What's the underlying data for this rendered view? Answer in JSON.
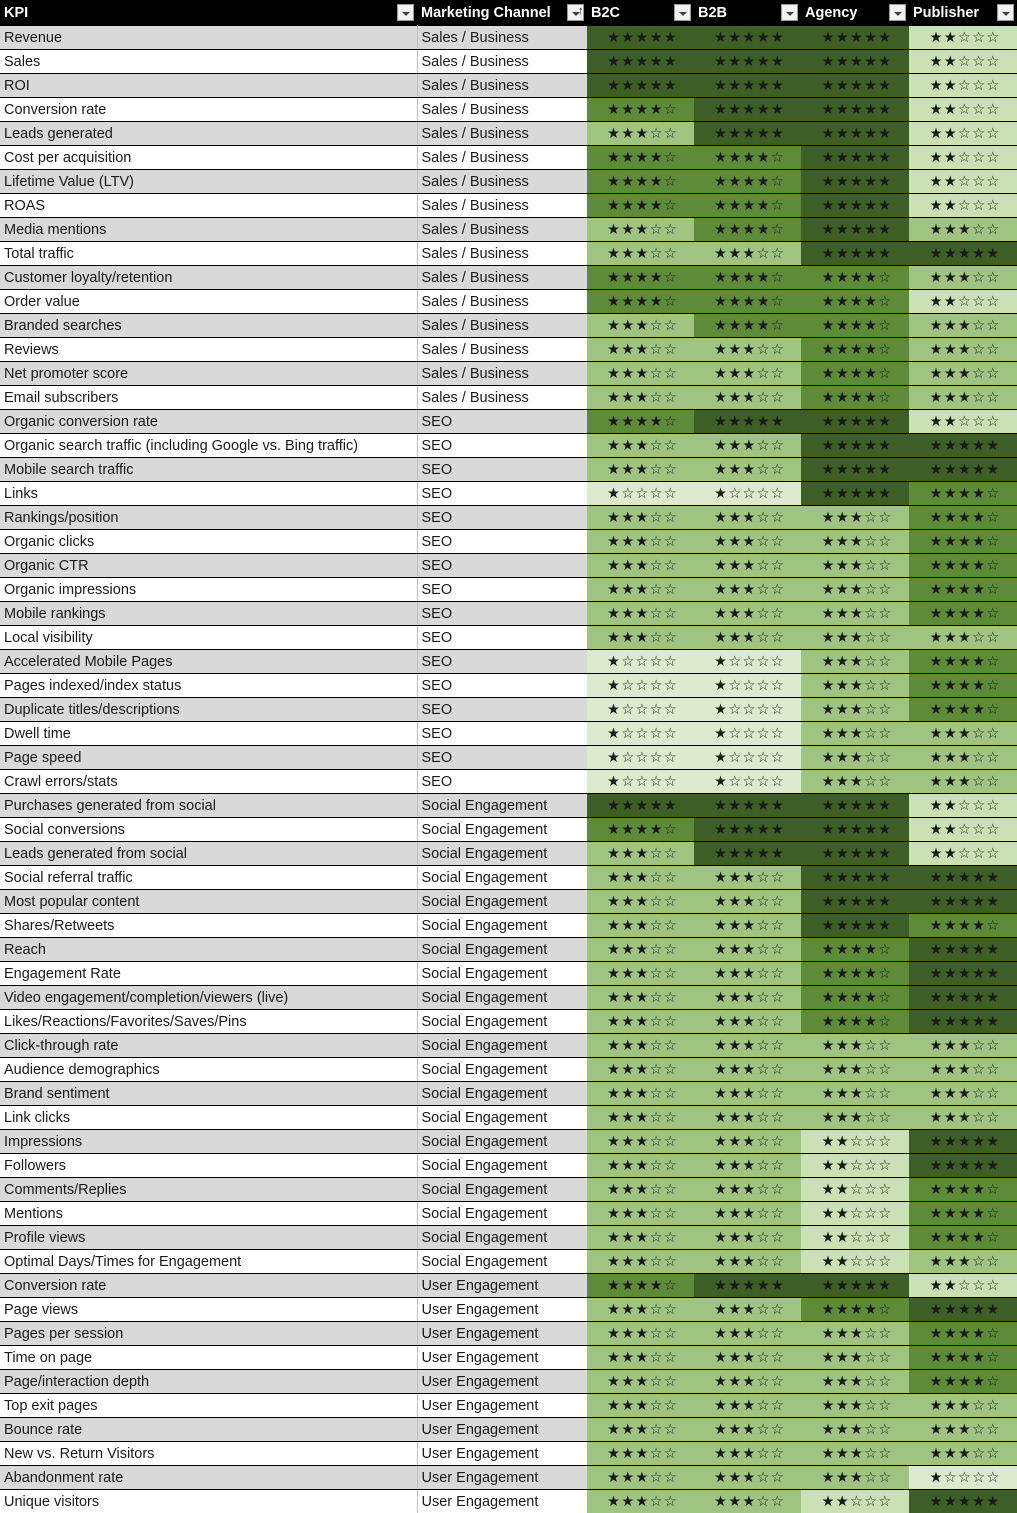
{
  "table": {
    "columns": [
      {
        "key": "kpi",
        "label": "KPI",
        "filter_icon": "chevron-down-icon",
        "sorted": false
      },
      {
        "key": "channel",
        "label": "Marketing Channel",
        "filter_icon": "chevron-down-icon",
        "sorted": true,
        "sort_indicator": "sort-ascending-icon"
      },
      {
        "key": "b2c",
        "label": "B2C",
        "filter_icon": "chevron-down-icon",
        "sorted": false
      },
      {
        "key": "b2b",
        "label": "B2B",
        "filter_icon": "chevron-down-icon",
        "sorted": false
      },
      {
        "key": "agency",
        "label": "Agency",
        "filter_icon": "chevron-down-icon",
        "sorted": false
      },
      {
        "key": "publisher",
        "label": "Publisher",
        "filter_icon": "chevron-down-icon",
        "sorted": false
      }
    ],
    "rating_scale": {
      "max": 5,
      "filled_glyph": "★",
      "empty_glyph": "☆"
    },
    "rating_colors": {
      "5": "#3d5e25",
      "4": "#5d8b39",
      "3": "#9fc482",
      "2": "#c9e1b5",
      "1": "#dcebcd"
    },
    "row_stripe_colors": {
      "odd": "#d9d9d9",
      "even": "#ffffff"
    },
    "rows": [
      {
        "kpi": "Revenue",
        "channel": "Sales / Business",
        "b2c": 5,
        "b2b": 5,
        "agency": 5,
        "publisher": 2
      },
      {
        "kpi": "Sales",
        "channel": "Sales / Business",
        "b2c": 5,
        "b2b": 5,
        "agency": 5,
        "publisher": 2
      },
      {
        "kpi": "ROI",
        "channel": "Sales / Business",
        "b2c": 5,
        "b2b": 5,
        "agency": 5,
        "publisher": 2
      },
      {
        "kpi": "Conversion rate",
        "channel": "Sales / Business",
        "b2c": 4,
        "b2b": 5,
        "agency": 5,
        "publisher": 2
      },
      {
        "kpi": "Leads generated",
        "channel": "Sales / Business",
        "b2c": 3,
        "b2b": 5,
        "agency": 5,
        "publisher": 2
      },
      {
        "kpi": "Cost per acquisition",
        "channel": "Sales / Business",
        "b2c": 4,
        "b2b": 4,
        "agency": 5,
        "publisher": 2
      },
      {
        "kpi": "Lifetime Value (LTV)",
        "channel": "Sales / Business",
        "b2c": 4,
        "b2b": 4,
        "agency": 5,
        "publisher": 2
      },
      {
        "kpi": "ROAS",
        "channel": "Sales / Business",
        "b2c": 4,
        "b2b": 4,
        "agency": 5,
        "publisher": 2
      },
      {
        "kpi": "Media mentions",
        "channel": "Sales / Business",
        "b2c": 3,
        "b2b": 4,
        "agency": 5,
        "publisher": 3
      },
      {
        "kpi": "Total traffic",
        "channel": "Sales / Business",
        "b2c": 3,
        "b2b": 3,
        "agency": 5,
        "publisher": 5
      },
      {
        "kpi": "Customer loyalty/retention",
        "channel": "Sales / Business",
        "b2c": 4,
        "b2b": 4,
        "agency": 4,
        "publisher": 3
      },
      {
        "kpi": "Order value",
        "channel": "Sales / Business",
        "b2c": 4,
        "b2b": 4,
        "agency": 4,
        "publisher": 2
      },
      {
        "kpi": "Branded searches",
        "channel": "Sales / Business",
        "b2c": 3,
        "b2b": 4,
        "agency": 4,
        "publisher": 3
      },
      {
        "kpi": "Reviews",
        "channel": "Sales / Business",
        "b2c": 3,
        "b2b": 3,
        "agency": 4,
        "publisher": 3
      },
      {
        "kpi": "Net promoter score",
        "channel": "Sales / Business",
        "b2c": 3,
        "b2b": 3,
        "agency": 4,
        "publisher": 3
      },
      {
        "kpi": "Email subscribers",
        "channel": "Sales / Business",
        "b2c": 3,
        "b2b": 3,
        "agency": 4,
        "publisher": 3
      },
      {
        "kpi": "Organic conversion rate",
        "channel": "SEO",
        "b2c": 4,
        "b2b": 5,
        "agency": 5,
        "publisher": 2
      },
      {
        "kpi": "Organic search traffic (including Google vs. Bing traffic)",
        "channel": "SEO",
        "b2c": 3,
        "b2b": 3,
        "agency": 5,
        "publisher": 5
      },
      {
        "kpi": "Mobile search traffic",
        "channel": "SEO",
        "b2c": 3,
        "b2b": 3,
        "agency": 5,
        "publisher": 5
      },
      {
        "kpi": "Links",
        "channel": "SEO",
        "b2c": 1,
        "b2b": 1,
        "agency": 5,
        "publisher": 4
      },
      {
        "kpi": "Rankings/position",
        "channel": "SEO",
        "b2c": 3,
        "b2b": 3,
        "agency": 3,
        "publisher": 4
      },
      {
        "kpi": "Organic clicks",
        "channel": "SEO",
        "b2c": 3,
        "b2b": 3,
        "agency": 3,
        "publisher": 4
      },
      {
        "kpi": "Organic CTR",
        "channel": "SEO",
        "b2c": 3,
        "b2b": 3,
        "agency": 3,
        "publisher": 4
      },
      {
        "kpi": "Organic impressions",
        "channel": "SEO",
        "b2c": 3,
        "b2b": 3,
        "agency": 3,
        "publisher": 4
      },
      {
        "kpi": "Mobile rankings",
        "channel": "SEO",
        "b2c": 3,
        "b2b": 3,
        "agency": 3,
        "publisher": 4
      },
      {
        "kpi": "Local visibility",
        "channel": "SEO",
        "b2c": 3,
        "b2b": 3,
        "agency": 3,
        "publisher": 3
      },
      {
        "kpi": "Accelerated Mobile Pages",
        "channel": "SEO",
        "b2c": 1,
        "b2b": 1,
        "agency": 3,
        "publisher": 4
      },
      {
        "kpi": "Pages indexed/index status",
        "channel": "SEO",
        "b2c": 1,
        "b2b": 1,
        "agency": 3,
        "publisher": 4
      },
      {
        "kpi": "Duplicate titles/descriptions",
        "channel": "SEO",
        "b2c": 1,
        "b2b": 1,
        "agency": 3,
        "publisher": 4
      },
      {
        "kpi": "Dwell time",
        "channel": "SEO",
        "b2c": 1,
        "b2b": 1,
        "agency": 3,
        "publisher": 3
      },
      {
        "kpi": "Page speed",
        "channel": "SEO",
        "b2c": 1,
        "b2b": 1,
        "agency": 3,
        "publisher": 3
      },
      {
        "kpi": "Crawl errors/stats",
        "channel": "SEO",
        "b2c": 1,
        "b2b": 1,
        "agency": 3,
        "publisher": 3
      },
      {
        "kpi": "Purchases generated from social",
        "channel": "Social Engagement",
        "b2c": 5,
        "b2b": 5,
        "agency": 5,
        "publisher": 2
      },
      {
        "kpi": "Social conversions",
        "channel": "Social Engagement",
        "b2c": 4,
        "b2b": 5,
        "agency": 5,
        "publisher": 2
      },
      {
        "kpi": "Leads generated from social",
        "channel": "Social Engagement",
        "b2c": 3,
        "b2b": 5,
        "agency": 5,
        "publisher": 2
      },
      {
        "kpi": "Social referral traffic",
        "channel": "Social Engagement",
        "b2c": 3,
        "b2b": 3,
        "agency": 5,
        "publisher": 5
      },
      {
        "kpi": "Most popular content",
        "channel": "Social Engagement",
        "b2c": 3,
        "b2b": 3,
        "agency": 5,
        "publisher": 5
      },
      {
        "kpi": "Shares/Retweets",
        "channel": "Social Engagement",
        "b2c": 3,
        "b2b": 3,
        "agency": 5,
        "publisher": 4
      },
      {
        "kpi": "Reach",
        "channel": "Social Engagement",
        "b2c": 3,
        "b2b": 3,
        "agency": 4,
        "publisher": 5
      },
      {
        "kpi": "Engagement Rate",
        "channel": "Social Engagement",
        "b2c": 3,
        "b2b": 3,
        "agency": 4,
        "publisher": 5
      },
      {
        "kpi": "Video engagement/completion/viewers (live)",
        "channel": "Social Engagement",
        "b2c": 3,
        "b2b": 3,
        "agency": 4,
        "publisher": 5
      },
      {
        "kpi": "Likes/Reactions/Favorites/Saves/Pins",
        "channel": "Social Engagement",
        "b2c": 3,
        "b2b": 3,
        "agency": 4,
        "publisher": 5
      },
      {
        "kpi": "Click-through rate",
        "channel": "Social Engagement",
        "b2c": 3,
        "b2b": 3,
        "agency": 3,
        "publisher": 3
      },
      {
        "kpi": "Audience demographics",
        "channel": "Social Engagement",
        "b2c": 3,
        "b2b": 3,
        "agency": 3,
        "publisher": 3
      },
      {
        "kpi": "Brand sentiment",
        "channel": "Social Engagement",
        "b2c": 3,
        "b2b": 3,
        "agency": 3,
        "publisher": 3
      },
      {
        "kpi": "Link clicks",
        "channel": "Social Engagement",
        "b2c": 3,
        "b2b": 3,
        "agency": 3,
        "publisher": 3
      },
      {
        "kpi": "Impressions",
        "channel": "Social Engagement",
        "b2c": 3,
        "b2b": 3,
        "agency": 2,
        "publisher": 5
      },
      {
        "kpi": "Followers",
        "channel": "Social Engagement",
        "b2c": 3,
        "b2b": 3,
        "agency": 2,
        "publisher": 5
      },
      {
        "kpi": "Comments/Replies",
        "channel": "Social Engagement",
        "b2c": 3,
        "b2b": 3,
        "agency": 2,
        "publisher": 4
      },
      {
        "kpi": "Mentions",
        "channel": "Social Engagement",
        "b2c": 3,
        "b2b": 3,
        "agency": 2,
        "publisher": 4
      },
      {
        "kpi": "Profile views",
        "channel": "Social Engagement",
        "b2c": 3,
        "b2b": 3,
        "agency": 2,
        "publisher": 4
      },
      {
        "kpi": "Optimal Days/Times for Engagement",
        "channel": "Social Engagement",
        "b2c": 3,
        "b2b": 3,
        "agency": 2,
        "publisher": 3
      },
      {
        "kpi": "Conversion rate",
        "channel": "User Engagement",
        "b2c": 4,
        "b2b": 5,
        "agency": 5,
        "publisher": 2
      },
      {
        "kpi": "Page views",
        "channel": "User Engagement",
        "b2c": 3,
        "b2b": 3,
        "agency": 4,
        "publisher": 5
      },
      {
        "kpi": "Pages per session",
        "channel": "User Engagement",
        "b2c": 3,
        "b2b": 3,
        "agency": 3,
        "publisher": 4
      },
      {
        "kpi": "Time on page",
        "channel": "User Engagement",
        "b2c": 3,
        "b2b": 3,
        "agency": 3,
        "publisher": 4
      },
      {
        "kpi": "Page/interaction depth",
        "channel": "User Engagement",
        "b2c": 3,
        "b2b": 3,
        "agency": 3,
        "publisher": 4
      },
      {
        "kpi": "Top exit pages",
        "channel": "User Engagement",
        "b2c": 3,
        "b2b": 3,
        "agency": 3,
        "publisher": 3
      },
      {
        "kpi": "Bounce rate",
        "channel": "User Engagement",
        "b2c": 3,
        "b2b": 3,
        "agency": 3,
        "publisher": 3
      },
      {
        "kpi": "New vs. Return Visitors",
        "channel": "User Engagement",
        "b2c": 3,
        "b2b": 3,
        "agency": 3,
        "publisher": 3
      },
      {
        "kpi": "Abandonment rate",
        "channel": "User Engagement",
        "b2c": 3,
        "b2b": 3,
        "agency": 3,
        "publisher": 1
      },
      {
        "kpi": "Unique visitors",
        "channel": "User Engagement",
        "b2c": 3,
        "b2b": 3,
        "agency": 2,
        "publisher": 5
      }
    ]
  }
}
